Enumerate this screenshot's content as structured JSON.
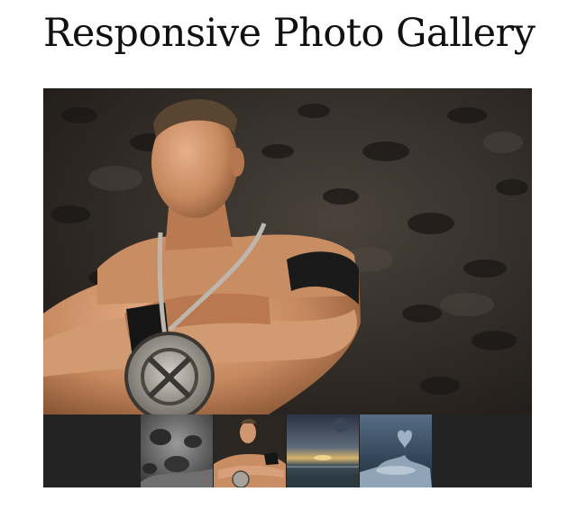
{
  "page": {
    "title": "Responsive Photo Gallery"
  },
  "gallery": {
    "main_image": {
      "alt": "Wrestler with arms crossed wearing a chain medallion",
      "selected_thumbnail": 2
    },
    "thumbnails": [
      {
        "alt": "Grey abstract sculpture"
      },
      {
        "alt": "Wrestler with arms crossed"
      },
      {
        "alt": "Sunset over the sea"
      },
      {
        "alt": "Heart splashing in water"
      }
    ]
  }
}
